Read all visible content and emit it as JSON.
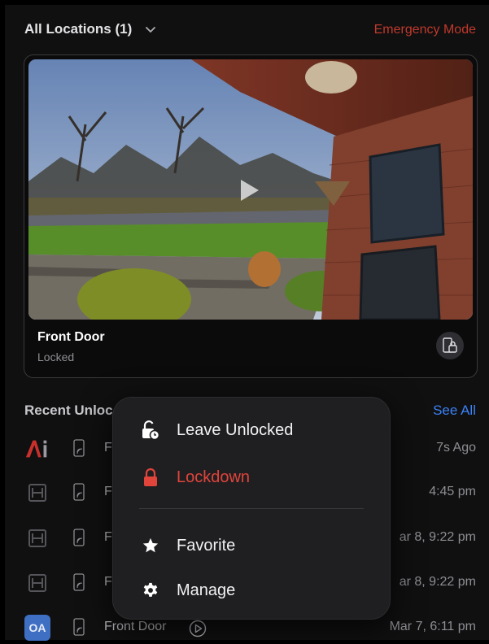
{
  "header": {
    "location_selector": "All Locations (1)",
    "emergency_mode": "Emergency Mode"
  },
  "camera_card": {
    "door_name": "Front Door",
    "status": "Locked"
  },
  "recent": {
    "heading": "Recent Unloc",
    "see_all": "See All",
    "rows": [
      {
        "avatar": "ai-logo",
        "door": "F",
        "time": "7s Ago"
      },
      {
        "avatar": "hallway-logo",
        "door": "F",
        "time": "4:45 pm"
      },
      {
        "avatar": "hallway-logo",
        "door": "F",
        "time": "ar 8, 9:22 pm"
      },
      {
        "avatar": "hallway-logo",
        "door": "F",
        "time": "ar 8, 9:22 pm"
      },
      {
        "avatar": "OA",
        "door": "Front Door",
        "time": "Mar 7, 6:11 pm"
      }
    ]
  },
  "menu": {
    "items": [
      {
        "label": "Leave Unlocked",
        "icon": "unlocked-clock-icon"
      },
      {
        "label": "Lockdown",
        "icon": "lock-icon",
        "color": "#e0443b"
      },
      {
        "label": "Favorite",
        "icon": "star-icon"
      },
      {
        "label": "Manage",
        "icon": "gear-icon"
      }
    ]
  },
  "colors": {
    "accent_blue": "#3b82f6",
    "danger_red": "#e0443b",
    "emergency_red": "#c0392b"
  }
}
